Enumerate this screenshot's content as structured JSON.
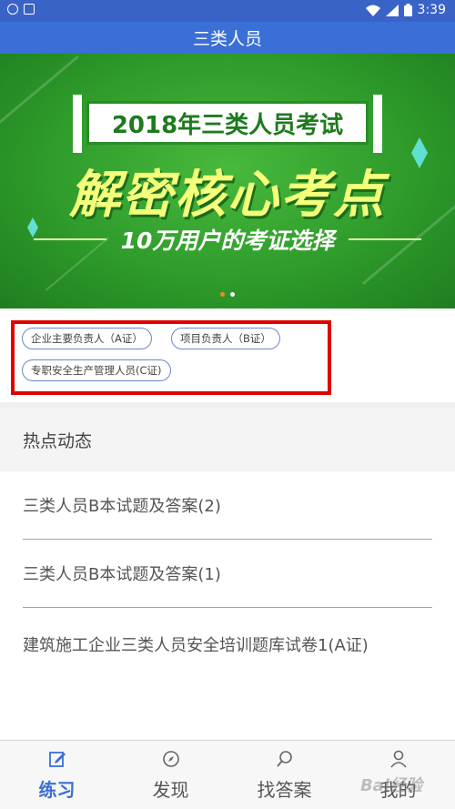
{
  "status_bar": {
    "time": "3:39",
    "left_icons": [
      "notification-icon",
      "image-icon"
    ],
    "right_icons": [
      "wifi-icon",
      "signal-icon",
      "battery-icon"
    ]
  },
  "app_bar": {
    "title": "三类人员"
  },
  "banner": {
    "title": "2018年三类人员考试",
    "headline": "解密核心考点",
    "subtitle": "10万用户的考证选择",
    "page_count": 2,
    "active_index": 0,
    "colors": {
      "active_dot": "#f08a24",
      "inactive_dot": "#ffffff"
    }
  },
  "tags": [
    {
      "label": "企业主要负责人（A证）"
    },
    {
      "label": "项目负责人（B证）"
    },
    {
      "label": "专职安全生产管理人员(C证)"
    }
  ],
  "hot_section": {
    "title": "热点动态"
  },
  "news": [
    {
      "title": "三类人员B本试题及答案(2)"
    },
    {
      "title": "三类人员B本试题及答案(1)"
    },
    {
      "title": "建筑施工企业三类人员安全培训题库试卷1(A证)"
    }
  ],
  "bottom_nav": [
    {
      "label": "练习",
      "icon": "edit-icon",
      "active": true
    },
    {
      "label": "发现",
      "icon": "compass-icon",
      "active": false
    },
    {
      "label": "找答案",
      "icon": "search-icon",
      "active": false
    },
    {
      "label": "我的",
      "icon": "user-icon",
      "active": false
    }
  ],
  "colors": {
    "accent": "#3a6fd6",
    "highlight_box": "#e00000"
  },
  "watermark": "Bai经验"
}
